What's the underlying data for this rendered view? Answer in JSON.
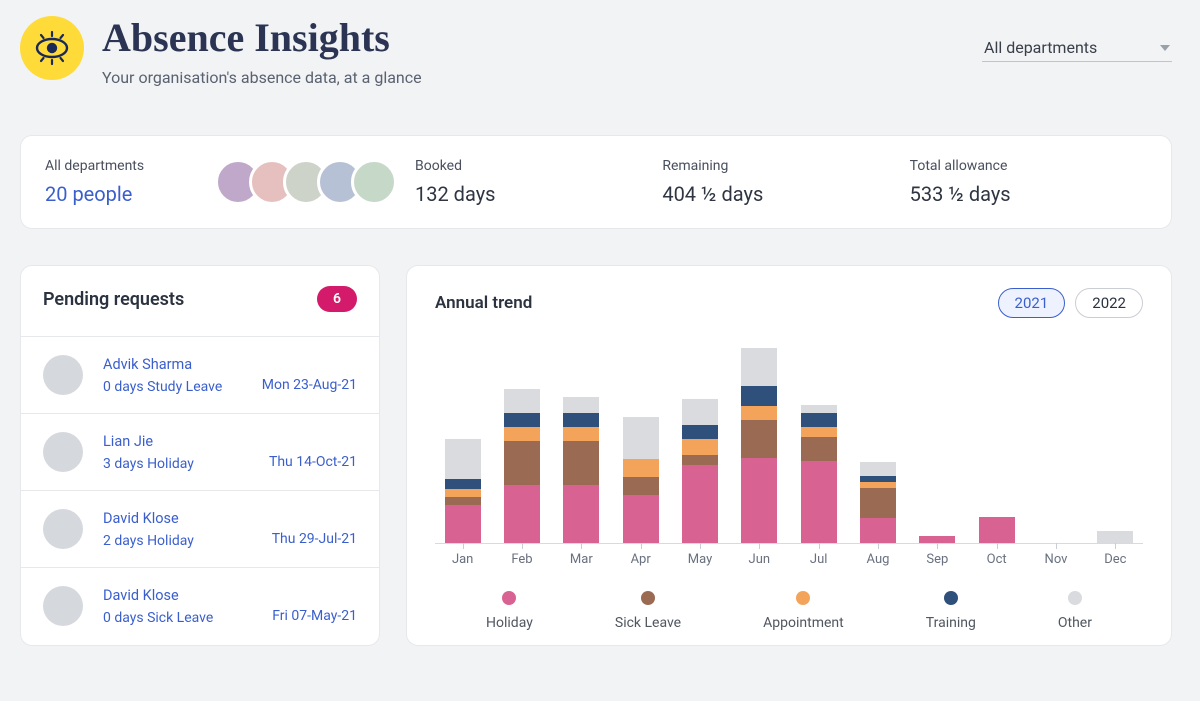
{
  "header": {
    "title": "Absence Insights",
    "subtitle": "Your organisation's absence data, at a glance"
  },
  "filter": {
    "selected": "All departments"
  },
  "summary": {
    "scope_label": "All departments",
    "people_value": "20 people",
    "booked_label": "Booked",
    "booked_value": "132 days",
    "remaining_label": "Remaining",
    "remaining_value": "404 ½ days",
    "allowance_label": "Total allowance",
    "allowance_value": "533 ½ days"
  },
  "pending": {
    "title": "Pending requests",
    "count": "6",
    "items": [
      {
        "name": "Advik Sharma",
        "meta": "0 days  Study Leave",
        "date": "Mon 23-Aug-21"
      },
      {
        "name": "Lian Jie",
        "meta": "3 days  Holiday",
        "date": "Thu 14-Oct-21"
      },
      {
        "name": "David Klose",
        "meta": "2 days  Holiday",
        "date": "Thu 29-Jul-21"
      },
      {
        "name": "David Klose",
        "meta": "0 days  Sick Leave",
        "date": "Fri 07-May-21"
      }
    ]
  },
  "trend": {
    "title": "Annual trend",
    "years": [
      "2021",
      "2022"
    ],
    "active_year": "2021",
    "legend": [
      "Holiday",
      "Sick Leave",
      "Appointment",
      "Training",
      "Other"
    ]
  },
  "chart_data": {
    "type": "bar",
    "stacked": true,
    "categories": [
      "Jan",
      "Feb",
      "Mar",
      "Apr",
      "May",
      "Jun",
      "Jul",
      "Aug",
      "Sep",
      "Oct",
      "Nov",
      "Dec"
    ],
    "series": [
      {
        "name": "Holiday",
        "color": "#d86292",
        "values": [
          38,
          58,
          58,
          48,
          78,
          85,
          82,
          25,
          7,
          26,
          0,
          0
        ]
      },
      {
        "name": "Sick Leave",
        "color": "#9a6a53",
        "values": [
          8,
          44,
          44,
          18,
          10,
          38,
          24,
          30,
          0,
          0,
          0,
          0
        ]
      },
      {
        "name": "Appointment",
        "color": "#f4a45a",
        "values": [
          8,
          14,
          14,
          18,
          16,
          14,
          10,
          6,
          0,
          0,
          0,
          0
        ]
      },
      {
        "name": "Training",
        "color": "#2e507a",
        "values": [
          10,
          14,
          14,
          0,
          14,
          20,
          14,
          6,
          0,
          0,
          0,
          0
        ]
      },
      {
        "name": "Other",
        "color": "#d9dbde",
        "values": [
          40,
          24,
          16,
          42,
          26,
          38,
          8,
          14,
          0,
          0,
          0,
          12
        ]
      }
    ],
    "ylim": [
      0,
      200
    ]
  }
}
